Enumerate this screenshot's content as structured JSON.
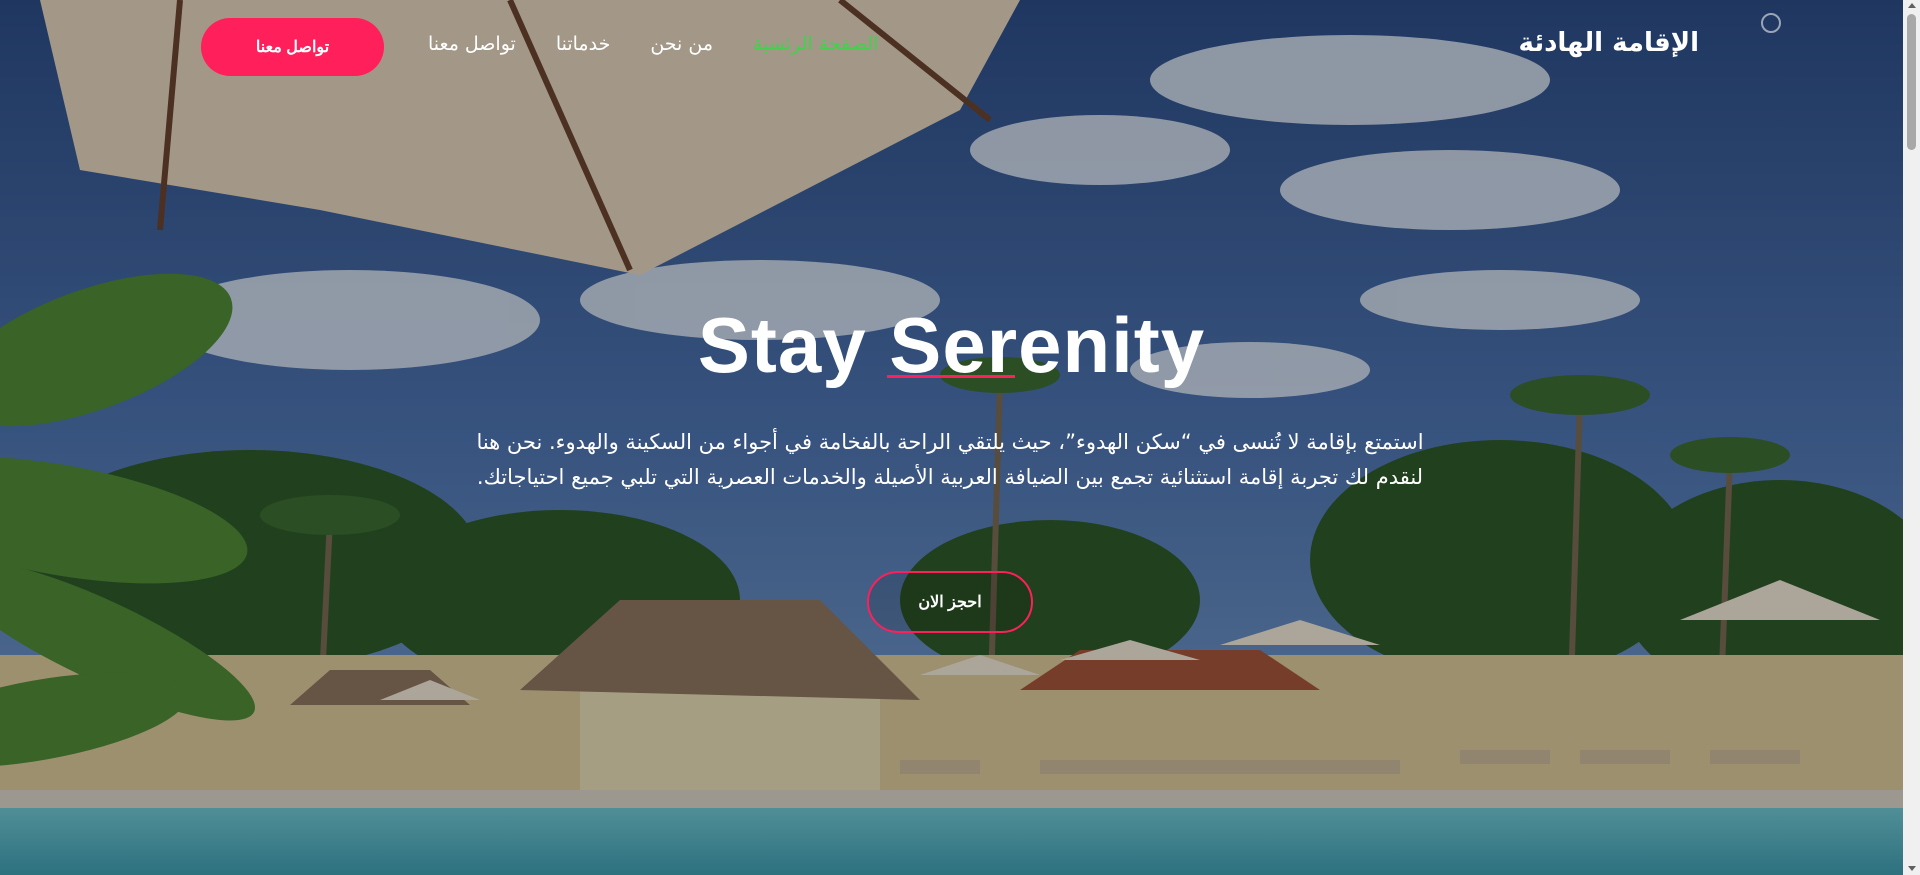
{
  "header": {
    "brand": "الإقامة الهادئة",
    "nav": [
      {
        "label": "الصفحة الرئسية",
        "active": true
      },
      {
        "label": "من نحن",
        "active": false
      },
      {
        "label": "خدماتنا",
        "active": false
      },
      {
        "label": "تواصل معنا",
        "active": false
      }
    ],
    "cta_label": "تواصل معنا"
  },
  "hero": {
    "title": "Stay Serenity",
    "description": "استمتع بإقامة لا تُنسى في “سكن الهدوء”، حيث يلتقي الراحة بالفخامة في أجواء من السكينة والهدوء. نحن هنا لنقدم لك تجربة إقامة استثنائية تجمع بين الضيافة العربية الأصيلة والخدمات العصرية التي تلبي جميع احتياجاتك.",
    "book_label": "احجز الان"
  },
  "colors": {
    "accent": "#ff1f5a",
    "nav_active": "#3fd34a",
    "text": "#ffffff"
  },
  "icons": {
    "watermark": "site-logo-icon"
  }
}
